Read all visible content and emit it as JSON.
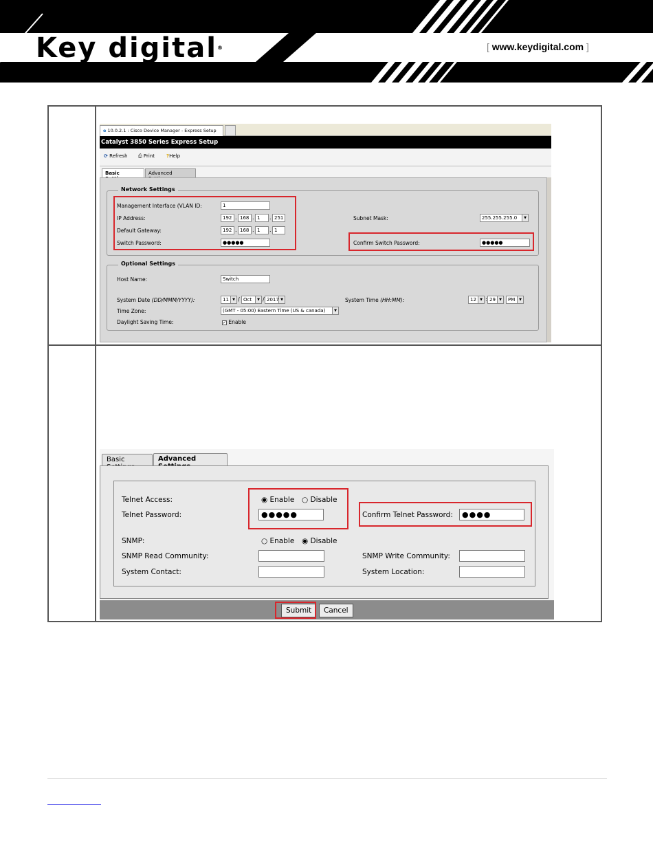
{
  "header": {
    "logo_text": "Key digital",
    "registered_mark": "®",
    "website_open": "[",
    "website": "www.keydigital.com",
    "website_close": "]"
  },
  "screenshot1": {
    "browser_tab_title": "10.0.2.1 : Cisco Device Manager - Express Setup",
    "app_title": "Catalyst 3850 Series Express Setup",
    "toolbar": {
      "refresh": "Refresh",
      "print": "Print",
      "help": "Help"
    },
    "tabs": {
      "basic": "Basic Settings",
      "advanced": "Advanced Settings"
    },
    "network": {
      "legend": "Network Settings",
      "mgmt_label": "Management Interface (VLAN ID:",
      "mgmt_value": "1",
      "ip_label": "IP Address:",
      "ip": [
        "192",
        "168",
        "1",
        "251"
      ],
      "gateway_label": "Default Gateway:",
      "gateway": [
        "192",
        "168",
        "1",
        "1"
      ],
      "subnet_label": "Subnet Mask:",
      "subnet_value": "255.255.255.0",
      "switch_pw_label": "Switch Password:",
      "switch_pw_value": "●●●●●",
      "confirm_pw_label": "Confirm Switch Password:",
      "confirm_pw_value": "●●●●●"
    },
    "optional": {
      "legend": "Optional Settings",
      "host_label": "Host Name:",
      "host_value": "Switch",
      "date_label": "System Date",
      "date_format": "(DD/MMM/YYYY):",
      "day": "11",
      "month": "Oct",
      "year": "2017",
      "time_label": "System Time",
      "time_format": "(HH:MM):",
      "hour": "12",
      "minute": "29",
      "ampm": "PM",
      "tz_label": "Time Zone:",
      "tz_value": "(GMT - 05:00) Eastern Time (US & canada)",
      "dst_label": "Daylight Saving Time:",
      "dst_option": "Enable"
    }
  },
  "screenshot2": {
    "tabs": {
      "basic": "Basic Settings",
      "advanced": "Advanced Settings"
    },
    "telnet_access_label": "Telnet Access:",
    "telnet_enable": "Enable",
    "telnet_disable": "Disable",
    "telnet_pw_label": "Telnet Password:",
    "telnet_pw_value": "●●●●●",
    "confirm_telnet_label": "Confirm Telnet Password:",
    "confirm_telnet_value": "●●●●",
    "snmp_label": "SNMP:",
    "snmp_enable": "Enable",
    "snmp_disable": "Disable",
    "snmp_read_label": "SNMP Read Community:",
    "snmp_write_label": "SNMP Write Community:",
    "contact_label": "System Contact:",
    "location_label": "System Location:",
    "submit": "Submit",
    "cancel": "Cancel"
  },
  "colors": {
    "highlight": "#d8262c",
    "banner": "#000000"
  }
}
